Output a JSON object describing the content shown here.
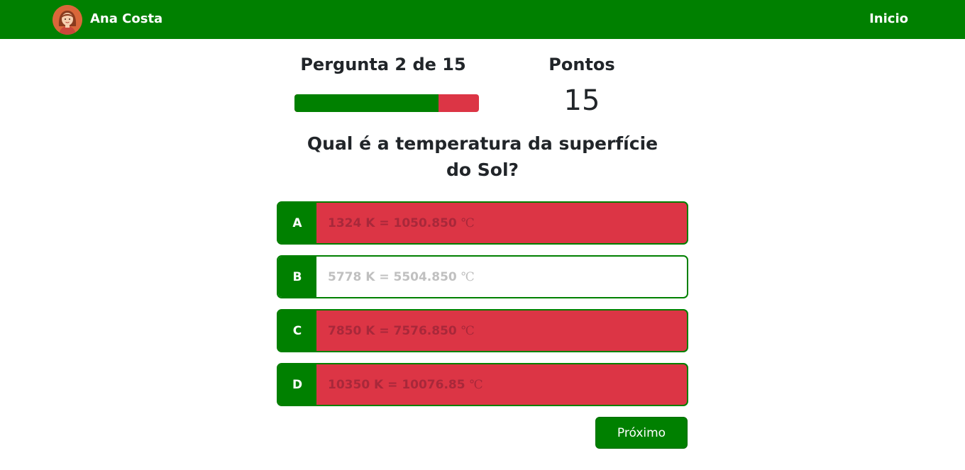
{
  "navbar": {
    "user_name": "Ana Costa",
    "home_label": "Inicio",
    "avatar_icon": "woman-avatar-icon"
  },
  "quiz": {
    "progress_label": "Pergunta 2 de 15",
    "progress_fraction": 0.78,
    "score_label": "Pontos",
    "score_value": "15",
    "question": "Qual é a temperatura da superfície do Sol?",
    "options": [
      {
        "letter": "A",
        "text": "1324 K = 1050.850",
        "unit": "℃",
        "state": "wrong"
      },
      {
        "letter": "B",
        "text": "5778 K = 5504.850",
        "unit": "℃",
        "state": "normal"
      },
      {
        "letter": "C",
        "text": "7850 K = 7576.850",
        "unit": "℃",
        "state": "wrong"
      },
      {
        "letter": "D",
        "text": "10350 K = 10076.85",
        "unit": "℃",
        "state": "wrong"
      }
    ],
    "next_label": "Próximo"
  },
  "colors": {
    "primary": "#008000",
    "danger": "#dc3545",
    "white": "#ffffff"
  }
}
